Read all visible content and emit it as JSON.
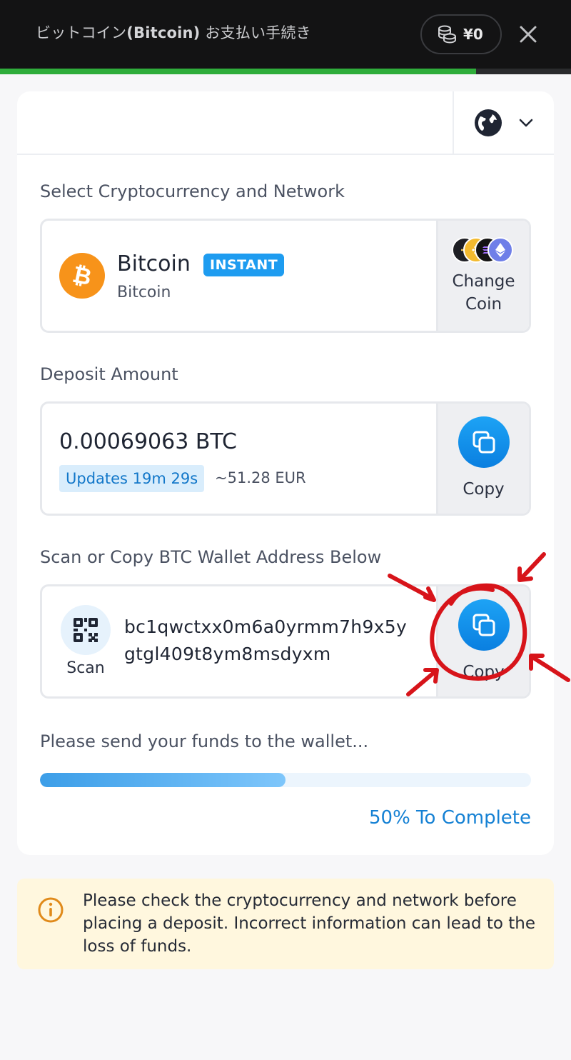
{
  "header": {
    "title_prefix": "ビットコイン",
    "title_bold": "(Bitcoin)",
    "title_suffix": " お支払い手続き",
    "balance": "¥0",
    "progress_percent": 83.4
  },
  "crypto_section": {
    "label": "Select Cryptocurrency and Network",
    "coin_name": "Bitcoin",
    "badge": "INSTANT",
    "network": "Bitcoin",
    "change_coin_label": "Change Coin"
  },
  "deposit_section": {
    "label": "Deposit Amount",
    "amount": "0.00069063 BTC",
    "timer": "Updates 19m 29s",
    "fiat_equivalent": "~51.28 EUR",
    "copy_label": "Copy"
  },
  "wallet_section": {
    "label": "Scan or Copy BTC Wallet Address Below",
    "scan_label": "Scan",
    "address": "bc1qwctxx0m6a0yrmm7h9x5ygtgl409t8ym8msdyxm",
    "copy_label": "Copy"
  },
  "status": {
    "message": "Please send your funds to the wallet...",
    "progress_percent": 50,
    "complete_label": "50% To Complete"
  },
  "warning": {
    "text": "Please check the cryptocurrency and network before placing a deposit. Incorrect information can lead to the loss of funds."
  },
  "colors": {
    "accent": "#1e9cf0",
    "bitcoin": "#f7931a",
    "annotation": "#d7141a"
  }
}
